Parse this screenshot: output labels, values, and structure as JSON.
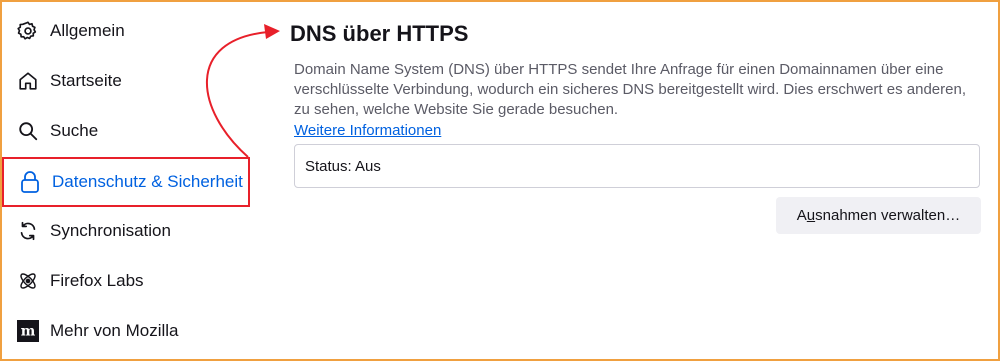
{
  "sidebar": {
    "items": [
      {
        "label": "Allgemein",
        "icon": "gear-icon"
      },
      {
        "label": "Startseite",
        "icon": "home-icon"
      },
      {
        "label": "Suche",
        "icon": "search-icon"
      },
      {
        "label": "Datenschutz & Sicherheit",
        "icon": "lock-icon",
        "selected": true
      },
      {
        "label": "Synchronisation",
        "icon": "sync-icon"
      },
      {
        "label": "Firefox Labs",
        "icon": "labs-icon"
      },
      {
        "label": "Mehr von Mozilla",
        "icon": "mozilla-icon"
      }
    ]
  },
  "main": {
    "title": "DNS über HTTPS",
    "description": "Domain Name System (DNS) über HTTPS sendet Ihre Anfrage für einen Domainnamen über eine verschlüsselte Verbindung, wodurch ein sicheres DNS bereitgestellt wird. Dies erschwert es anderen, zu sehen, welche Website Sie gerade besuchen.",
    "link": "Weitere Informationen",
    "status": "Status: Aus",
    "button": {
      "prefix": "A",
      "accesskey": "u",
      "suffix": "snahmen verwalten…"
    }
  },
  "colors": {
    "accent": "#0061e0",
    "annotation": "#e8202a",
    "frame": "#f0a040"
  }
}
